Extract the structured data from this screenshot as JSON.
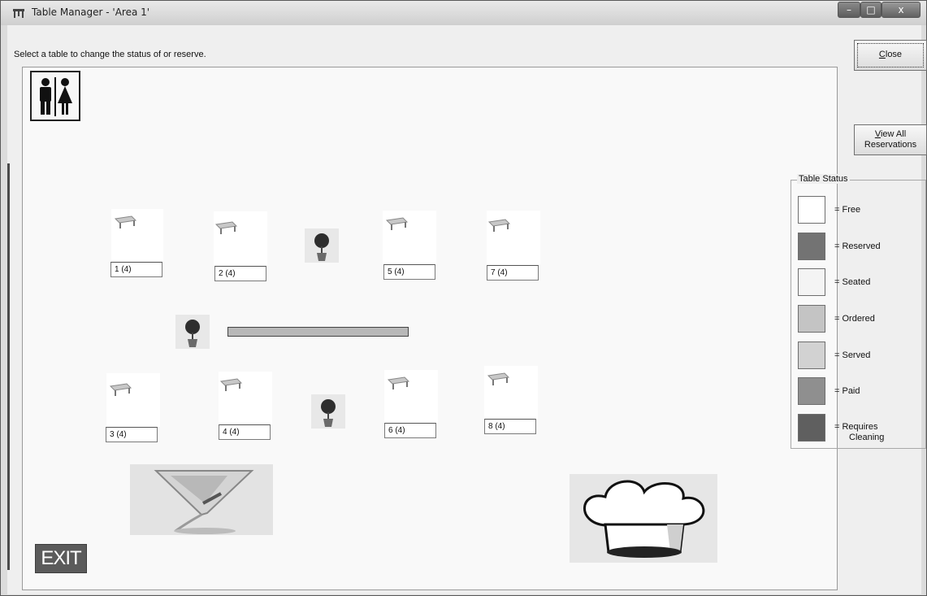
{
  "window": {
    "title": "Table Manager - 'Area 1'",
    "min_glyph": "–",
    "max_glyph": "□",
    "close_glyph": "x"
  },
  "instructions": "Select a table to change the status of or reserve.",
  "buttons": {
    "close": "Close",
    "close_mnemonic": "C",
    "close_rest": "lose",
    "view_all_line1_mnemonic": "V",
    "view_all_line1_rest": "iew All",
    "view_all_line2": "Reservations",
    "exit": "EXIT"
  },
  "tables": [
    {
      "label": "1  (4)"
    },
    {
      "label": "2  (4)"
    },
    {
      "label": "5  (4)"
    },
    {
      "label": "7  (4)"
    },
    {
      "label": "3  (4)"
    },
    {
      "label": "4  (4)"
    },
    {
      "label": "6  (4)"
    },
    {
      "label": "8  (4)"
    }
  ],
  "table_status": {
    "title": "Table Status",
    "items": [
      {
        "label": "=   Free",
        "color": "#ffffff"
      },
      {
        "label": "=   Reserved",
        "color": "#737373"
      },
      {
        "label": "=   Seated",
        "color": "#f4f4f4"
      },
      {
        "label": "=   Ordered",
        "color": "#c4c4c4"
      },
      {
        "label": "=   Served",
        "color": "#d2d2d2"
      },
      {
        "label": "=   Paid",
        "color": "#8f8f8f"
      },
      {
        "label": "=   Requires",
        "label2": "Cleaning",
        "color": "#5f5f5f"
      }
    ]
  },
  "icons": {
    "restroom": "restroom-icon",
    "table": "table-icon",
    "plant": "plant-icon",
    "cocktail": "cocktail-glass-icon",
    "chef": "chef-hat-icon"
  }
}
